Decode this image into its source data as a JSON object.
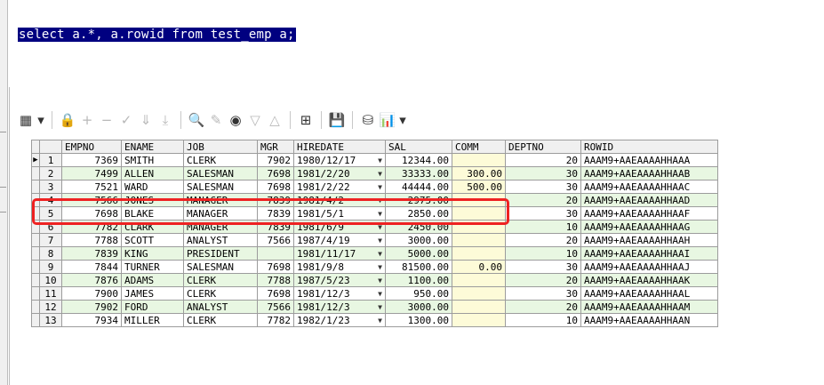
{
  "sql_editor": {
    "query": "select a.*, a.rowid from test_emp a;"
  },
  "toolbar": {
    "buttons": [
      {
        "name": "grid-view-icon",
        "glyph": "▦",
        "enabled": true
      },
      {
        "name": "dropdown-arrow-icon",
        "glyph": "▾",
        "enabled": true
      },
      {
        "name": "lock-icon",
        "glyph": "🔒",
        "enabled": true
      },
      {
        "name": "add-record-icon",
        "glyph": "+",
        "enabled": false
      },
      {
        "name": "delete-record-icon",
        "glyph": "−",
        "enabled": false
      },
      {
        "name": "post-changes-icon",
        "glyph": "✓",
        "enabled": false
      },
      {
        "name": "fetch-next-icon",
        "glyph": "⇓",
        "enabled": false
      },
      {
        "name": "fetch-all-icon",
        "glyph": "⤓",
        "enabled": false
      },
      {
        "name": "find-icon",
        "glyph": "🔍",
        "enabled": true
      },
      {
        "name": "clear-icon",
        "glyph": "✎",
        "enabled": false
      },
      {
        "name": "query-by-example-icon",
        "glyph": "◉",
        "enabled": true
      },
      {
        "name": "next-record-icon",
        "glyph": "▽",
        "enabled": false
      },
      {
        "name": "previous-record-icon",
        "glyph": "△",
        "enabled": false
      },
      {
        "name": "single-record-view-icon",
        "glyph": "⊞",
        "enabled": true
      },
      {
        "name": "save-icon",
        "glyph": "💾",
        "enabled": true
      },
      {
        "name": "export-icon",
        "glyph": "⛁",
        "enabled": true
      },
      {
        "name": "chart-icon",
        "glyph": "📊",
        "enabled": true
      },
      {
        "name": "chart-dropdown-icon",
        "glyph": "▾",
        "enabled": true
      }
    ]
  },
  "grid": {
    "columns": [
      "EMPNO",
      "ENAME",
      "JOB",
      "MGR",
      "HIREDATE",
      "SAL",
      "COMM",
      "DEPTNO",
      "ROWID"
    ],
    "rows": [
      {
        "n": "1",
        "empno": "7369",
        "ename": "SMITH",
        "job": "CLERK",
        "mgr": "7902",
        "hiredate": "1980/12/17",
        "sal": "12344.00",
        "comm": "",
        "deptno": "20",
        "rowid": "AAAM9+AAEAAAAHHAAA"
      },
      {
        "n": "2",
        "empno": "7499",
        "ename": "ALLEN",
        "job": "SALESMAN",
        "mgr": "7698",
        "hiredate": "1981/2/20",
        "sal": "33333.00",
        "comm": "300.00",
        "deptno": "30",
        "rowid": "AAAM9+AAEAAAAHHAAB"
      },
      {
        "n": "3",
        "empno": "7521",
        "ename": "WARD",
        "job": "SALESMAN",
        "mgr": "7698",
        "hiredate": "1981/2/22",
        "sal": "44444.00",
        "comm": "500.00",
        "deptno": "30",
        "rowid": "AAAM9+AAEAAAAHHAAC"
      },
      {
        "n": "4",
        "empno": "7566",
        "ename": "JONES",
        "job": "MANAGER",
        "mgr": "7839",
        "hiredate": "1981/4/2",
        "sal": "2975.00",
        "comm": "",
        "deptno": "20",
        "rowid": "AAAM9+AAEAAAAHHAAD"
      },
      {
        "n": "5",
        "empno": "7698",
        "ename": "BLAKE",
        "job": "MANAGER",
        "mgr": "7839",
        "hiredate": "1981/5/1",
        "sal": "2850.00",
        "comm": "",
        "deptno": "30",
        "rowid": "AAAM9+AAEAAAAHHAAF"
      },
      {
        "n": "6",
        "empno": "7782",
        "ename": "CLARK",
        "job": "MANAGER",
        "mgr": "7839",
        "hiredate": "1981/6/9",
        "sal": "2450.00",
        "comm": "",
        "deptno": "10",
        "rowid": "AAAM9+AAEAAAAHHAAG"
      },
      {
        "n": "7",
        "empno": "7788",
        "ename": "SCOTT",
        "job": "ANALYST",
        "mgr": "7566",
        "hiredate": "1987/4/19",
        "sal": "3000.00",
        "comm": "",
        "deptno": "20",
        "rowid": "AAAM9+AAEAAAAHHAAH"
      },
      {
        "n": "8",
        "empno": "7839",
        "ename": "KING",
        "job": "PRESIDENT",
        "mgr": "",
        "hiredate": "1981/11/17",
        "sal": "5000.00",
        "comm": "",
        "deptno": "10",
        "rowid": "AAAM9+AAEAAAAHHAAI"
      },
      {
        "n": "9",
        "empno": "7844",
        "ename": "TURNER",
        "job": "SALESMAN",
        "mgr": "7698",
        "hiredate": "1981/9/8",
        "sal": "81500.00",
        "comm": "0.00",
        "deptno": "30",
        "rowid": "AAAM9+AAEAAAAHHAAJ"
      },
      {
        "n": "10",
        "empno": "7876",
        "ename": "ADAMS",
        "job": "CLERK",
        "mgr": "7788",
        "hiredate": "1987/5/23",
        "sal": "1100.00",
        "comm": "",
        "deptno": "20",
        "rowid": "AAAM9+AAEAAAAHHAAK"
      },
      {
        "n": "11",
        "empno": "7900",
        "ename": "JAMES",
        "job": "CLERK",
        "mgr": "7698",
        "hiredate": "1981/12/3",
        "sal": "950.00",
        "comm": "",
        "deptno": "30",
        "rowid": "AAAM9+AAEAAAAHHAAL"
      },
      {
        "n": "12",
        "empno": "7902",
        "ename": "FORD",
        "job": "ANALYST",
        "mgr": "7566",
        "hiredate": "1981/12/3",
        "sal": "3000.00",
        "comm": "",
        "deptno": "20",
        "rowid": "AAAM9+AAEAAAAHHAAM"
      },
      {
        "n": "13",
        "empno": "7934",
        "ename": "MILLER",
        "job": "CLERK",
        "mgr": "7782",
        "hiredate": "1982/1/23",
        "sal": "1300.00",
        "comm": "",
        "deptno": "10",
        "rowid": "AAAM9+AAEAAAAHHAAN"
      }
    ]
  },
  "highlight": {
    "row": "4",
    "color": "#ee2222"
  },
  "colors": {
    "selection": "#000080",
    "alt_row": "#e8f7e2",
    "comm_cell": "#fdfbd8",
    "header": "#f0f0f0"
  }
}
